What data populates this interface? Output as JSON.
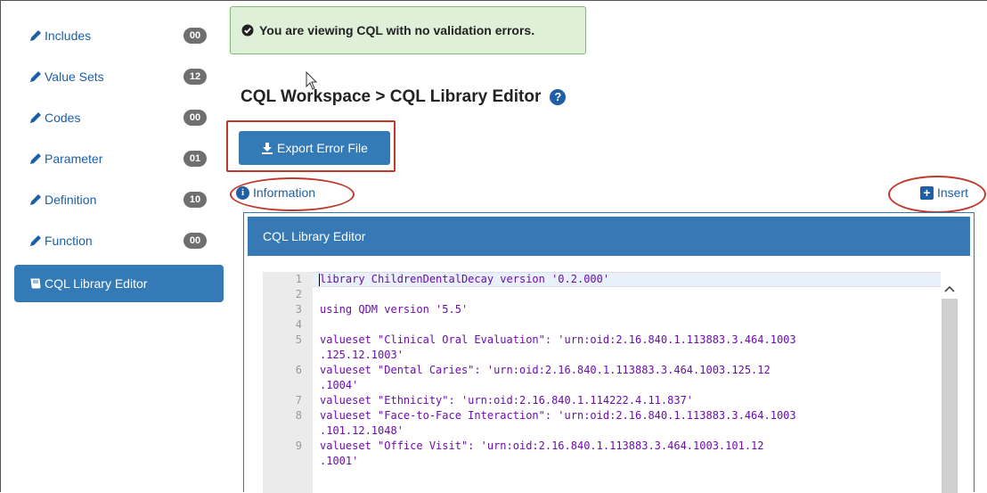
{
  "sidebar": {
    "items": [
      {
        "label": "Includes",
        "count": "00"
      },
      {
        "label": "Value Sets",
        "count": "12"
      },
      {
        "label": "Codes",
        "count": "00"
      },
      {
        "label": "Parameter",
        "count": "01"
      },
      {
        "label": "Definition",
        "count": "10"
      },
      {
        "label": "Function",
        "count": "00"
      }
    ],
    "active": {
      "label": "CQL Library Editor"
    }
  },
  "alert": {
    "text": "You are viewing CQL with no validation errors."
  },
  "page": {
    "title": "CQL Workspace > CQL Library Editor",
    "help_icon": "?"
  },
  "toolbar": {
    "export_label": "Export Error File",
    "info_label": "Information",
    "insert_label": "Insert"
  },
  "panel": {
    "title": "CQL Library Editor"
  },
  "editor": {
    "lines": [
      {
        "n": "1",
        "text": "library ChildrenDentalDecay version '0.2.000'"
      },
      {
        "n": "2",
        "text": ""
      },
      {
        "n": "3",
        "text": "using QDM version '5.5'"
      },
      {
        "n": "4",
        "text": ""
      },
      {
        "n": "5",
        "text": "valueset \"Clinical Oral Evaluation\": 'urn:oid:2.16.840.1.113883.3.464.1003"
      },
      {
        "n": "",
        "text": ".125.12.1003'"
      },
      {
        "n": "6",
        "text": "valueset \"Dental Caries\": 'urn:oid:2.16.840.1.113883.3.464.1003.125.12"
      },
      {
        "n": "",
        "text": ".1004'"
      },
      {
        "n": "7",
        "text": "valueset \"Ethnicity\": 'urn:oid:2.16.840.1.114222.4.11.837'"
      },
      {
        "n": "8",
        "text": "valueset \"Face-to-Face Interaction\": 'urn:oid:2.16.840.1.113883.3.464.1003"
      },
      {
        "n": "",
        "text": ".101.12.1048'"
      },
      {
        "n": "9",
        "text": "valueset \"Office Visit\": 'urn:oid:2.16.840.1.113883.3.464.1003.101.12"
      },
      {
        "n": "",
        "text": ".1001'"
      }
    ]
  },
  "colors": {
    "primary": "#337ab7",
    "alert_bg": "#dff0d8",
    "annotation": "#c0392b",
    "badge": "#6f6f6f"
  }
}
